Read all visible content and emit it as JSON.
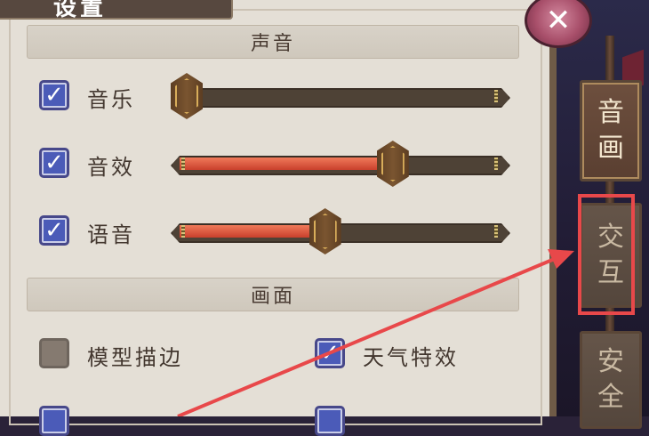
{
  "panel": {
    "title": "设置",
    "close_label": "✕"
  },
  "sections": {
    "sound": {
      "header": "声音",
      "rows": [
        {
          "label": "音乐",
          "checked": true,
          "level": 0.0
        },
        {
          "label": "音效",
          "checked": true,
          "level": 0.67
        },
        {
          "label": "语音",
          "checked": true,
          "level": 0.45
        }
      ]
    },
    "graphics": {
      "header": "画面",
      "options": [
        {
          "label": "模型描边",
          "checked": false
        },
        {
          "label": "天气特效",
          "checked": true
        }
      ]
    }
  },
  "side_tabs": [
    {
      "chars": [
        "音",
        "画"
      ],
      "state": "active"
    },
    {
      "chars": [
        "交",
        "互"
      ],
      "state": "inactive",
      "annotated": true
    },
    {
      "chars": [
        "安",
        "全"
      ],
      "state": "inactive"
    }
  ],
  "annotation": {
    "color": "#e8484a"
  },
  "colors": {
    "panel_bg": "#e4dfd6",
    "checkbox_on": "#4b5bb8",
    "slider_fill": "#e0583e",
    "knob_gold": "#d8ad5a"
  }
}
